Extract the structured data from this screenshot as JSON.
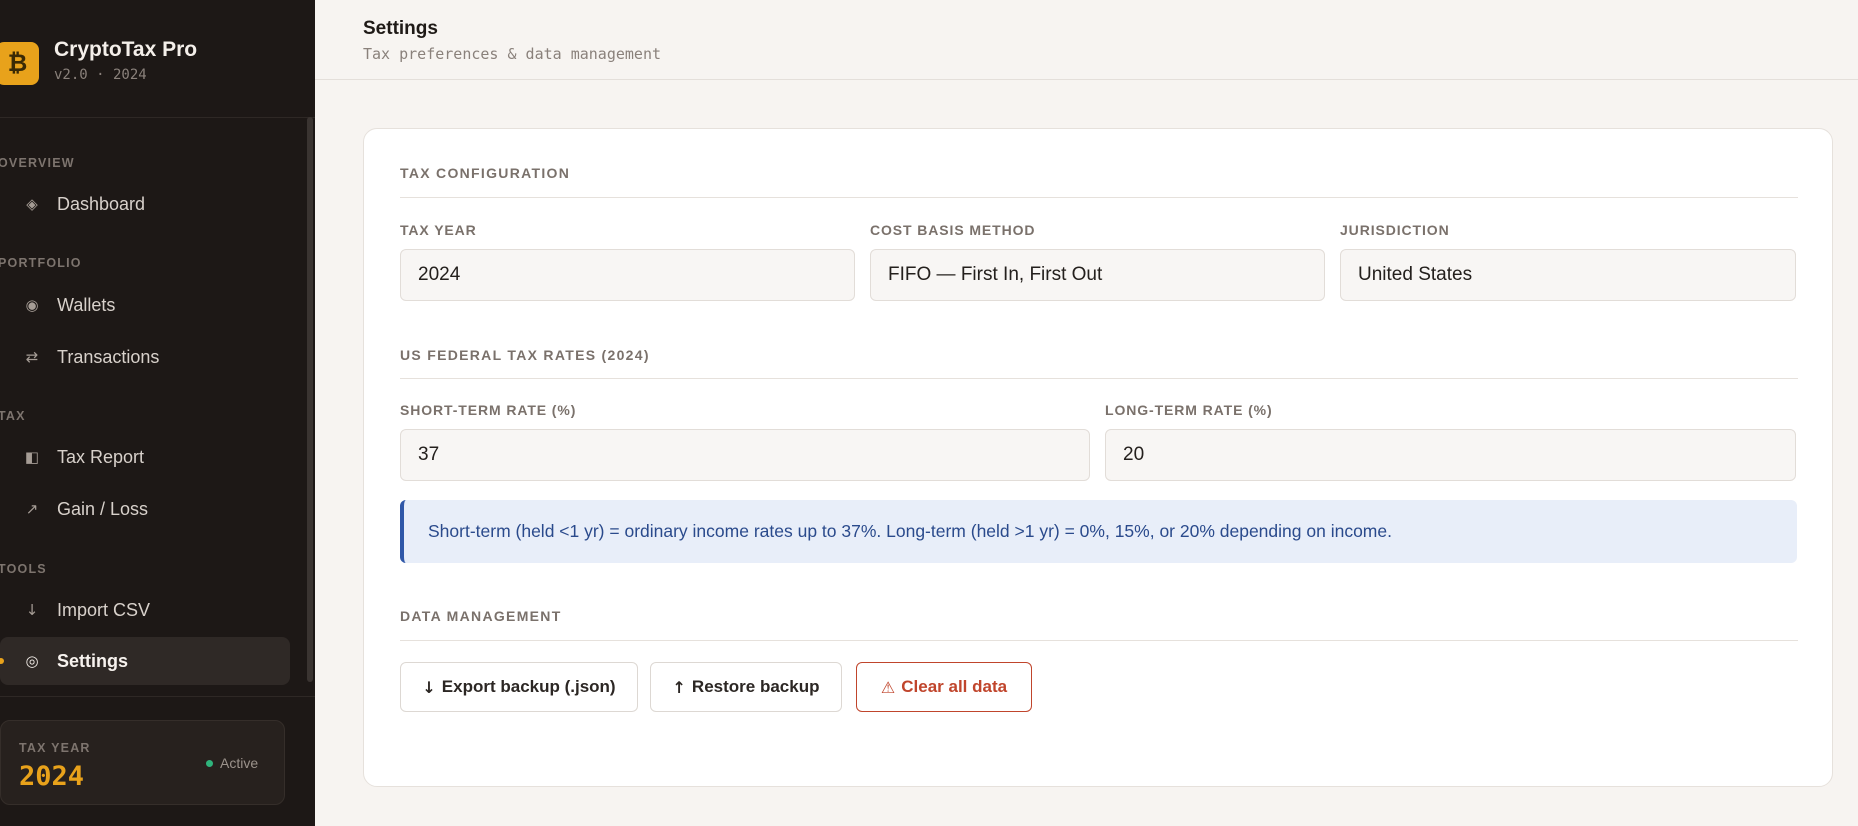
{
  "app": {
    "name": "CryptoTax Pro",
    "version": "v2.0 · 2024",
    "logo_glyph": "₿"
  },
  "sidebar": {
    "sections": [
      {
        "label": "OVERVIEW",
        "items": [
          {
            "label": "Dashboard",
            "icon": "diamond-icon",
            "glyph": "◈"
          }
        ]
      },
      {
        "label": "PORTFOLIO",
        "items": [
          {
            "label": "Wallets",
            "icon": "wallet-icon",
            "glyph": "◉"
          },
          {
            "label": "Transactions",
            "icon": "swap-icon",
            "glyph": "⇄"
          }
        ]
      },
      {
        "label": "TAX",
        "items": [
          {
            "label": "Tax Report",
            "icon": "report-icon",
            "glyph": "◧"
          },
          {
            "label": "Gain / Loss",
            "icon": "trend-icon",
            "glyph": "↗"
          }
        ]
      },
      {
        "label": "TOOLS",
        "items": [
          {
            "label": "Import CSV",
            "icon": "import-icon",
            "glyph": "↓"
          },
          {
            "label": "Settings",
            "icon": "settings-icon",
            "glyph": "◎",
            "active": true
          }
        ]
      }
    ],
    "year_card": {
      "label": "TAX YEAR",
      "value": "2024",
      "status": "Active"
    }
  },
  "header": {
    "title": "Settings",
    "subtitle": "Tax preferences & data management"
  },
  "tax_config": {
    "title": "TAX CONFIGURATION",
    "fields": [
      {
        "label": "TAX YEAR",
        "value": "2024"
      },
      {
        "label": "COST BASIS METHOD",
        "value": "FIFO — First In, First Out"
      },
      {
        "label": "JURISDICTION",
        "value": "United States"
      }
    ]
  },
  "rates": {
    "title": "US FEDERAL TAX RATES (2024)",
    "short_label": "SHORT-TERM RATE (%)",
    "short_value": "37",
    "long_label": "LONG-TERM RATE (%)",
    "long_value": "20",
    "info": "Short-term (held <1 yr) = ordinary income rates up to 37%. Long-term (held >1 yr) = 0%, 15%, or 20% depending on income."
  },
  "data_mgmt": {
    "title": "DATA MANAGEMENT",
    "export_glyph": "↓",
    "export_label": "Export backup (.json)",
    "restore_glyph": "↑",
    "restore_label": "Restore backup",
    "clear_glyph": "⚠",
    "clear_label": "Clear all data"
  },
  "colors": {
    "accent": "#e8a21b",
    "sidebar_bg": "#1d1816",
    "danger": "#c0452c",
    "info": "#2f57a8",
    "active_status": "#2fb47c"
  }
}
